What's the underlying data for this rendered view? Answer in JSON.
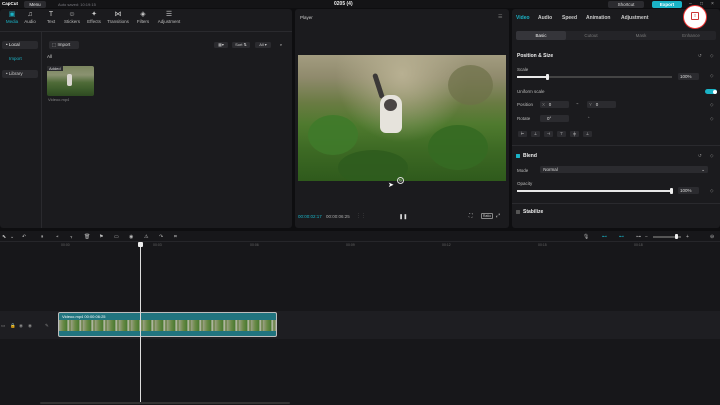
{
  "app": {
    "logo": "CapCut",
    "menu": "Menu",
    "autosave": "Auto saved: 10:19:15",
    "project_title": "0205 (4)",
    "shortcut": "Shortcut",
    "export": "Export"
  },
  "media_toolbar": {
    "items": [
      {
        "label": "Media",
        "icon": "media-icon"
      },
      {
        "label": "Audio",
        "icon": "audio-icon"
      },
      {
        "label": "Text",
        "icon": "text-icon"
      },
      {
        "label": "Stickers",
        "icon": "sticker-icon"
      },
      {
        "label": "Effects",
        "icon": "effects-icon"
      },
      {
        "label": "Transitions",
        "icon": "transitions-icon"
      },
      {
        "label": "Filters",
        "icon": "filters-icon"
      },
      {
        "label": "Adjustment",
        "icon": "adjustment-icon"
      }
    ]
  },
  "media_sidebar": {
    "local": "• Local",
    "import": "Import",
    "library": "• Library"
  },
  "media_main": {
    "import_button": "Import",
    "sort": "Sort",
    "filter_all": "All",
    "all_label": "All",
    "thumb_badge": "Added",
    "thumb_name": "Videoo.mp4"
  },
  "player": {
    "label": "Player",
    "time_current": "00:00:02:17",
    "time_total": "00:00:06:25",
    "ratio": "Ratio"
  },
  "inspector": {
    "tabs": [
      "Video",
      "Audio",
      "Speed",
      "Animation",
      "Adjustment"
    ],
    "subtabs": [
      "Basic",
      "Cutout",
      "Mask",
      "Enhance"
    ],
    "position_size": "Position & Size",
    "scale_label": "Scale",
    "scale_value": "100%",
    "uniform_scale": "Uniform scale",
    "position_label": "Position",
    "pos_x_axis": "X",
    "pos_x_value": "0",
    "pos_y_axis": "Y",
    "pos_y_value": "0",
    "rotate_label": "Rotate",
    "rotate_value": "0°",
    "blend": "Blend",
    "mode_label": "Mode",
    "mode_value": "Normal",
    "opacity_label": "Opacity",
    "opacity_value": "100%",
    "stabilize": "Stabilize"
  },
  "timeline": {
    "ticks": [
      "00:00",
      "00:03",
      "00:06",
      "00:09",
      "00:12",
      "00:15",
      "00:18"
    ],
    "clip_label": "Videoo.mp4   00:00:06:25"
  }
}
